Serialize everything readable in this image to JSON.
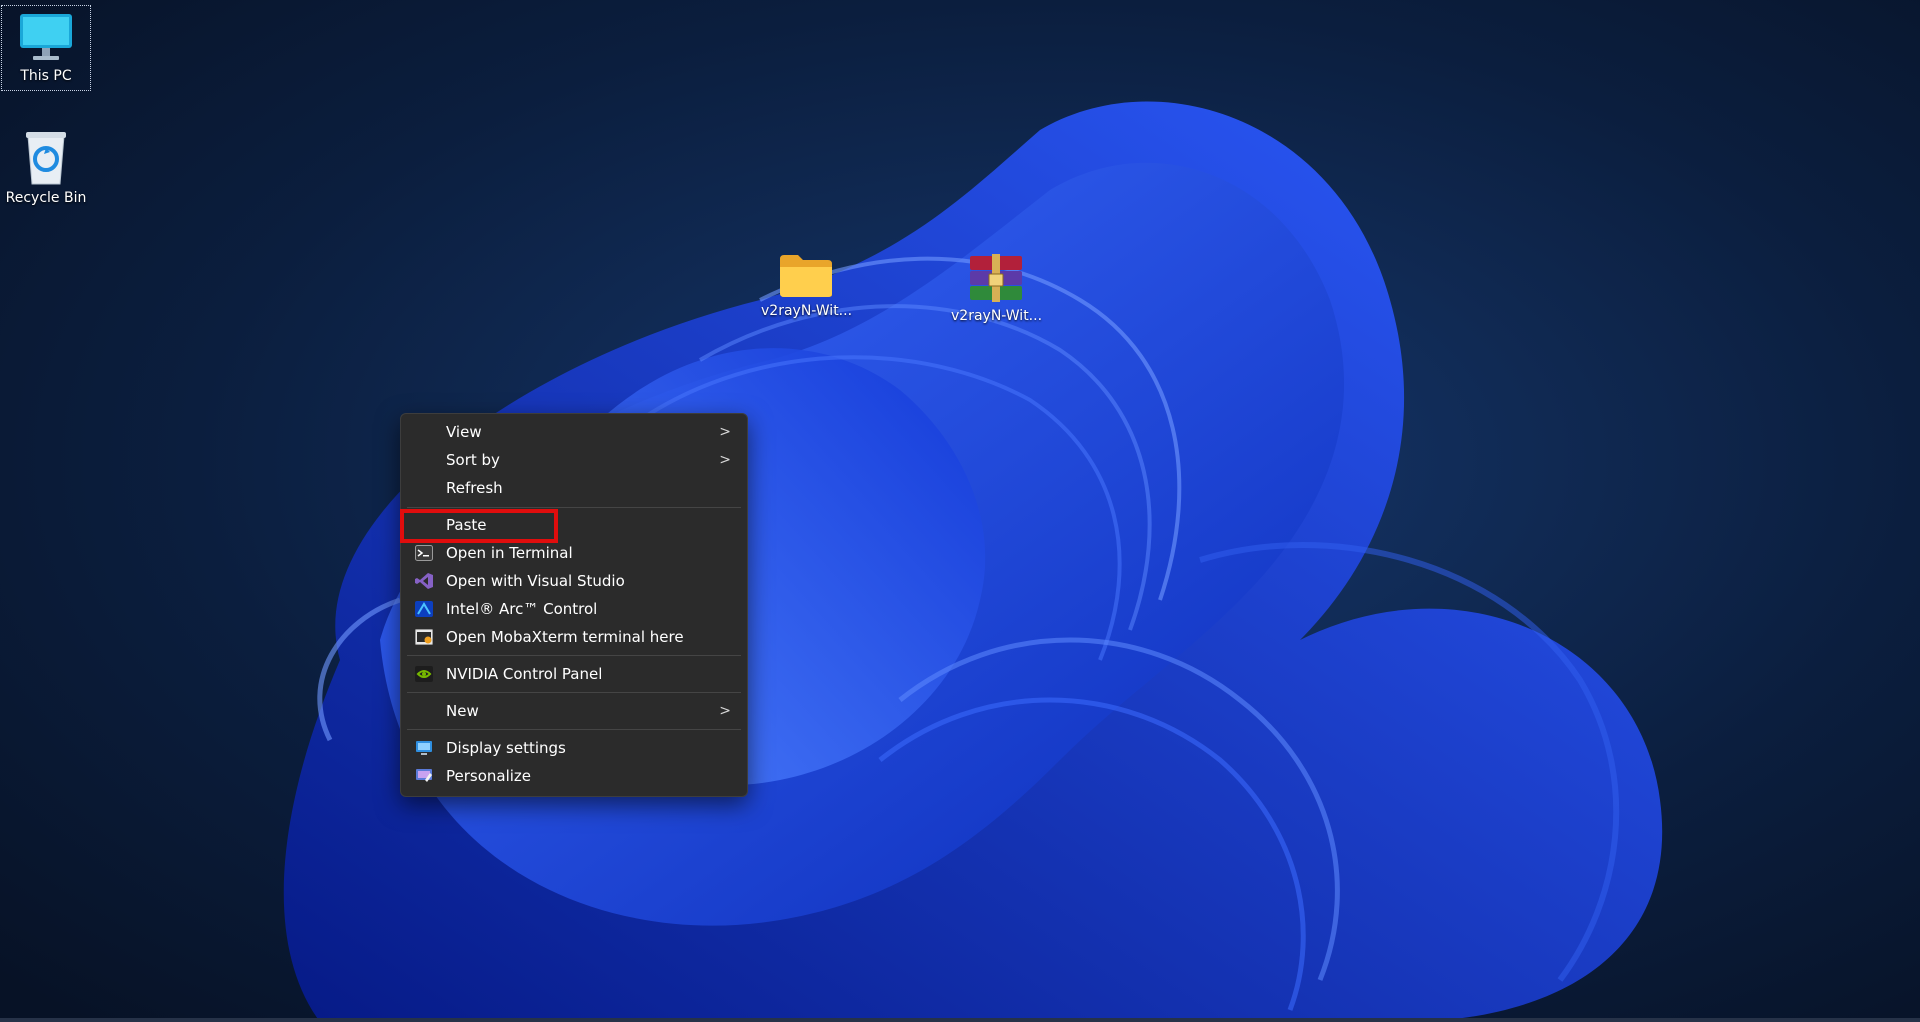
{
  "desktop": {
    "icons": [
      {
        "label": "This PC",
        "icon": "monitor-icon"
      },
      {
        "label": "Recycle Bin",
        "icon": "recycle-bin-icon"
      },
      {
        "label": "v2rayN-Wit...",
        "icon": "folder-icon"
      },
      {
        "label": "v2rayN-Wit...",
        "icon": "archive-icon"
      }
    ]
  },
  "context_menu": {
    "items": [
      {
        "label": "View",
        "submenu": true
      },
      {
        "label": "Sort by",
        "submenu": true
      },
      {
        "label": "Refresh"
      },
      {
        "label": "Paste",
        "highlighted": true
      },
      {
        "label": "Open in Terminal",
        "icon": "terminal-icon"
      },
      {
        "label": "Open with Visual Studio",
        "icon": "visual-studio-icon"
      },
      {
        "label": "Intel® Arc™ Control",
        "icon": "intel-arc-icon"
      },
      {
        "label": "Open MobaXterm terminal here",
        "icon": "mobaxterm-icon"
      },
      {
        "label": "NVIDIA Control Panel",
        "icon": "nvidia-icon"
      },
      {
        "label": "New",
        "submenu": true
      },
      {
        "label": "Display settings",
        "icon": "display-icon"
      },
      {
        "label": "Personalize",
        "icon": "personalize-icon"
      }
    ],
    "submenu_glyph": ">"
  },
  "colors": {
    "menu_bg": "#2b2b2b",
    "highlight_border": "#e00d0d",
    "wallpaper_accent": "#1f4ff0"
  }
}
